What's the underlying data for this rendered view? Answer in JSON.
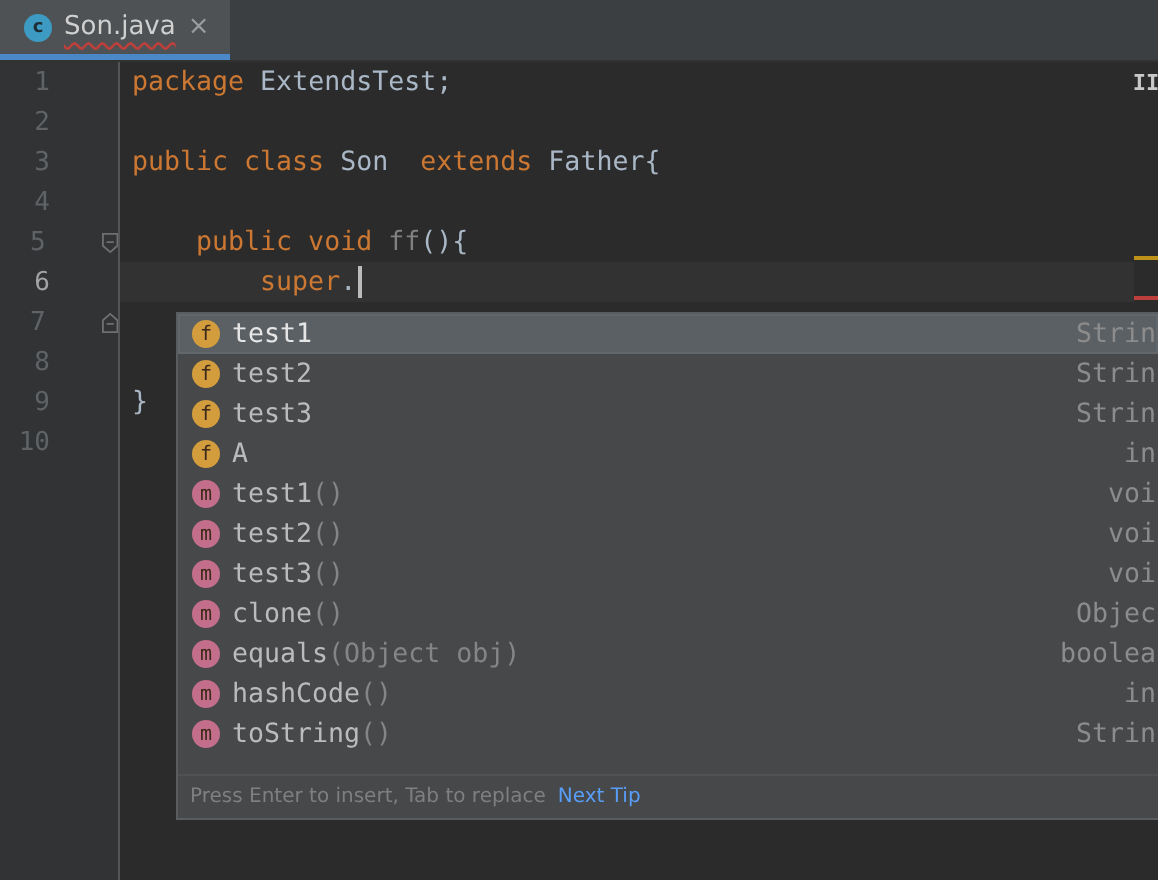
{
  "tabs": [
    {
      "label": "Son.java",
      "icon_letter": "c",
      "selected": true,
      "has_error": true,
      "close": "×"
    }
  ],
  "editor": {
    "lines": [
      {
        "number": "1",
        "current": false,
        "tokens": [
          {
            "text": "package",
            "kind": "keyword"
          },
          {
            "text": " ExtendsTest;",
            "kind": "plain"
          }
        ]
      },
      {
        "number": "2",
        "current": false
      },
      {
        "number": "3",
        "current": false,
        "tokens": [
          {
            "text": "public class",
            "kind": "keyword"
          },
          {
            "text": " Son  ",
            "kind": "plain"
          },
          {
            "text": "extends",
            "kind": "keyword"
          },
          {
            "text": " Father{",
            "kind": "plain"
          }
        ]
      },
      {
        "number": "4",
        "current": false
      },
      {
        "number": "5",
        "current": false,
        "fold_start": true,
        "tokens": [
          {
            "text": "    public void ",
            "kind": "keyword"
          },
          {
            "text": "ff",
            "kind": "unused"
          },
          {
            "text": "(){",
            "kind": "plain"
          }
        ]
      },
      {
        "number": "6",
        "current": true,
        "tokens": [
          {
            "text": "        super",
            "kind": "keyword"
          },
          {
            "text": ".",
            "kind": "plain"
          }
        ]
      },
      {
        "number": "7",
        "current": false,
        "fold_end": true
      },
      {
        "number": "8",
        "current": false
      },
      {
        "number": "9",
        "current": false,
        "tokens": [
          {
            "text": "}",
            "kind": "plain"
          }
        ]
      },
      {
        "number": "10",
        "current": false
      }
    ],
    "reader_mode": "II",
    "markers": [
      {
        "kind": "warning"
      },
      {
        "kind": "error"
      }
    ]
  },
  "completion": {
    "items": [
      {
        "kind": "field",
        "icon_letter": "f",
        "name": "test1",
        "type": "Strin",
        "selected": true
      },
      {
        "kind": "field",
        "icon_letter": "f",
        "name": "test2",
        "type": "Strin",
        "selected": false
      },
      {
        "kind": "field",
        "icon_letter": "f",
        "name": "test3",
        "type": "Strin",
        "selected": false
      },
      {
        "kind": "field",
        "icon_letter": "f",
        "name": "A",
        "type": "in",
        "selected": false
      },
      {
        "kind": "method",
        "icon_letter": "m",
        "name": "test1",
        "params": "()",
        "type": "voi",
        "selected": false
      },
      {
        "kind": "method",
        "icon_letter": "m",
        "name": "test2",
        "params": "()",
        "type": "voi",
        "selected": false
      },
      {
        "kind": "method",
        "icon_letter": "m",
        "name": "test3",
        "params": "()",
        "type": "voi",
        "selected": false
      },
      {
        "kind": "method",
        "icon_letter": "m",
        "name": "clone",
        "params": "()",
        "type": "Objec",
        "selected": false
      },
      {
        "kind": "method",
        "icon_letter": "m",
        "name": "equals",
        "params": "(Object obj)",
        "type": "boolea",
        "selected": false
      },
      {
        "kind": "method",
        "icon_letter": "m",
        "name": "hashCode",
        "params": "()",
        "type": "in",
        "selected": false
      },
      {
        "kind": "method",
        "icon_letter": "m",
        "name": "toString",
        "params": "()",
        "type": "Strin",
        "selected": false
      }
    ],
    "hint": "Press Enter to insert, Tab to replace",
    "hint_link": "Next Tip"
  }
}
